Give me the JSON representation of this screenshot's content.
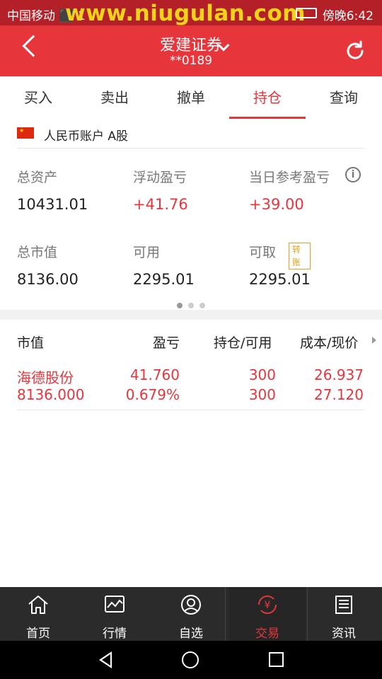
{
  "status_bar": {
    "carrier": "中国移动 ⬛ 1",
    "watermark": "www.niugulan.com",
    "time": "傍晚6:42"
  },
  "header": {
    "title": "爱建证券",
    "account_masked": "**0189"
  },
  "tabs": [
    {
      "label": "买入"
    },
    {
      "label": "卖出"
    },
    {
      "label": "撤单"
    },
    {
      "label": "持仓",
      "active": true
    },
    {
      "label": "查询"
    }
  ],
  "account": {
    "label": "人民币账户 A股",
    "flag": "cn-flag-icon"
  },
  "summary": {
    "total_assets": {
      "label": "总资产",
      "value": "10431.01"
    },
    "floating_pl": {
      "label": "浮动盈亏",
      "value": "+41.76"
    },
    "today_pl": {
      "label": "当日参考盈亏",
      "value": "+39.00"
    },
    "market_value": {
      "label": "总市值",
      "value": "8136.00"
    },
    "available": {
      "label": "可用",
      "value": "2295.01"
    },
    "withdrawable": {
      "label": "可取",
      "value": "2295.01",
      "badge": "转账"
    }
  },
  "table": {
    "headers": [
      "市值",
      "盈亏",
      "持仓/可用",
      "成本/现价"
    ],
    "rows": [
      {
        "name": "海德股份",
        "market_value": "8136.000",
        "pl": "41.760",
        "pl_pct": "0.679%",
        "position": "300",
        "available": "300",
        "cost": "26.937",
        "price": "27.120"
      }
    ]
  },
  "bottom_nav": [
    {
      "label": "首页",
      "icon": "home-icon"
    },
    {
      "label": "行情",
      "icon": "chart-icon"
    },
    {
      "label": "自选",
      "icon": "user-icon"
    },
    {
      "label": "交易",
      "icon": "yuan-icon",
      "active": true
    },
    {
      "label": "资讯",
      "icon": "news-icon"
    }
  ],
  "colors": {
    "accent": "#e6363c",
    "status_bar": "#b42028",
    "nav_bg": "#2b2b2b"
  }
}
